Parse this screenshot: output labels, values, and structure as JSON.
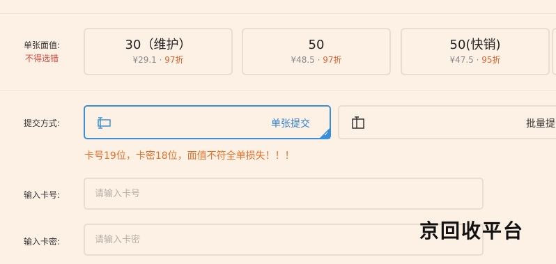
{
  "denomination": {
    "label": "单张面值:",
    "warning": "不得选错",
    "cards": [
      {
        "value": "30（维护）",
        "price": "¥29.1",
        "sep": " · ",
        "discount": "97折"
      },
      {
        "value": "50",
        "price": "¥48.5",
        "sep": " · ",
        "discount": "97折"
      },
      {
        "value": "50(快销)",
        "price": "¥47.5",
        "sep": " · ",
        "discount": "95折"
      }
    ]
  },
  "submit_method": {
    "label": "提交方式:",
    "options": [
      {
        "label": "单张提交",
        "icon": "single-card-icon",
        "selected": true
      },
      {
        "label": "批量提",
        "icon": "batch-card-icon",
        "selected": false
      }
    ]
  },
  "notice": "卡号19位，卡密18位，面值不符全单损失！！！",
  "card_number": {
    "label": "输入卡号:",
    "placeholder": "请输入卡号"
  },
  "card_password": {
    "label": "输入卡密:",
    "placeholder": "请输入卡密"
  },
  "watermark": "京回收平台",
  "colors": {
    "accent": "#3a8fdc",
    "warning": "#e04a3a",
    "discount": "#e0622f",
    "background": "#fdf1e6"
  }
}
